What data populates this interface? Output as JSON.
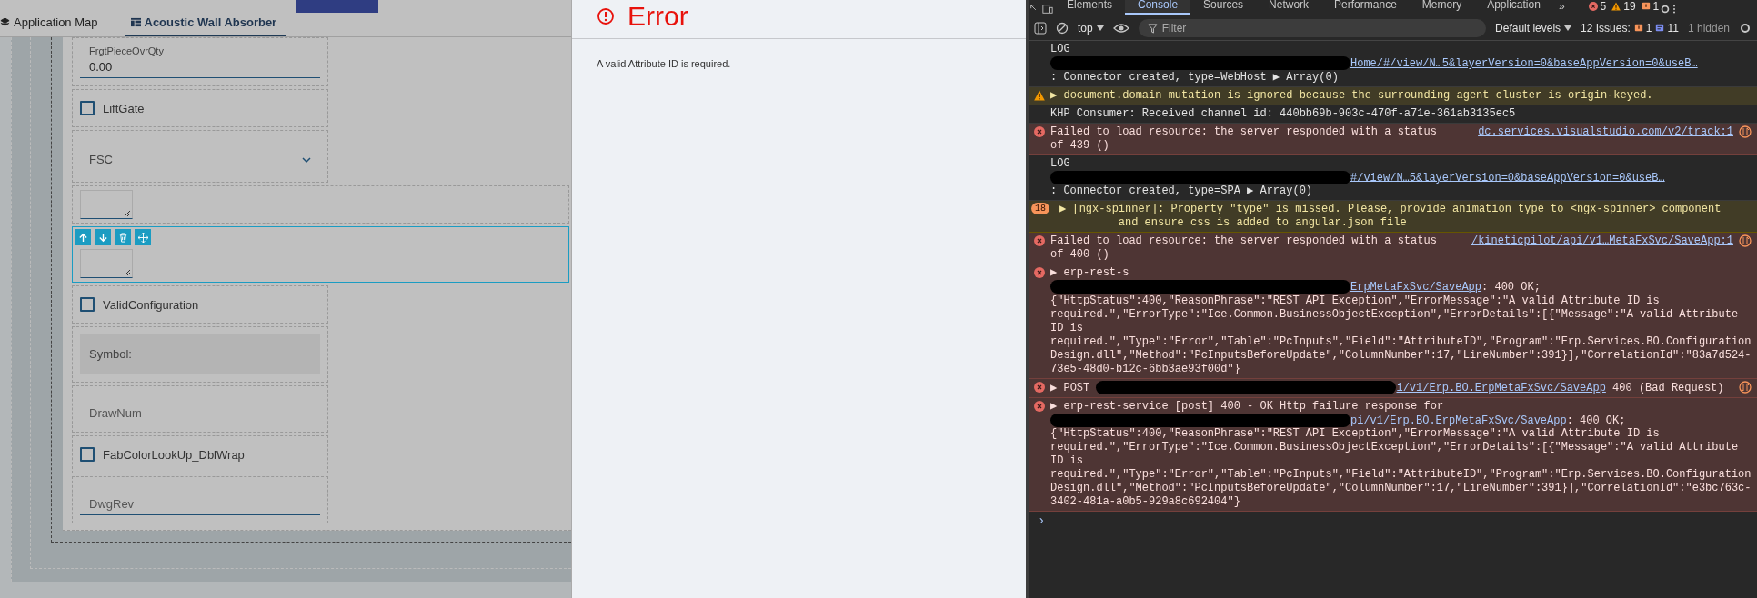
{
  "app": {
    "tabs": [
      {
        "label": "Application Map",
        "selected": false
      },
      {
        "label": "Acoustic Wall Absorber",
        "selected": true
      }
    ],
    "fields": [
      {
        "kind": "number",
        "label": "FrgtPieceOvrQty",
        "value": "0.00",
        "selected": false
      },
      {
        "kind": "checkbox",
        "label": "LiftGate",
        "checked": false,
        "selected": false
      },
      {
        "kind": "dropdown",
        "placeholder": "FSC",
        "selected": false
      },
      {
        "kind": "textarea",
        "selected": false
      },
      {
        "kind": "textarea",
        "selected": true
      },
      {
        "kind": "checkbox",
        "label": "ValidConfiguration",
        "checked": false,
        "selected": false
      },
      {
        "kind": "readonly",
        "placeholder": "Symbol:",
        "selected": false
      },
      {
        "kind": "text",
        "placeholder": "DrawNum",
        "selected": false
      },
      {
        "kind": "checkbox",
        "label": "FabColorLookUp_DblWrap",
        "checked": false,
        "selected": false
      },
      {
        "kind": "text",
        "placeholder": "DwgRev",
        "selected": false
      }
    ]
  },
  "error_dialog": {
    "title": "Error",
    "message": "A valid Attribute ID is required."
  },
  "devtools": {
    "tabs": [
      {
        "label": "Elements",
        "selected": false
      },
      {
        "label": "Console",
        "selected": true
      },
      {
        "label": "Sources",
        "selected": false
      },
      {
        "label": "Network",
        "selected": false
      },
      {
        "label": "Performance",
        "selected": false
      },
      {
        "label": "Memory",
        "selected": false
      },
      {
        "label": "Application",
        "selected": false
      }
    ],
    "more": "»",
    "error_count": "5",
    "warning_count": "19",
    "issue_count": "1",
    "toolbar": {
      "context": "top",
      "filter_placeholder": "Filter",
      "levels": "Default levels",
      "issues_label": "12 Issues:",
      "issues_errors": "1",
      "issues_info": "11",
      "hidden": "1 hidden"
    },
    "messages": [
      {
        "kind": "log",
        "segments": [
          {
            "kind": "text",
            "text": "LOG\n"
          },
          {
            "kind": "redaction"
          },
          {
            "kind": "link",
            "text": "Home/#/view/N…5&layerVersion=0&baseAppVersion=0&useB…"
          },
          {
            "kind": "text",
            "text": "\n: Connector created, type=WebHost ▶ Array(0)"
          }
        ]
      },
      {
        "kind": "warning",
        "segments": [
          {
            "kind": "text",
            "text": "▶ document.domain mutation is ignored because the surrounding agent cluster is origin-keyed."
          }
        ]
      },
      {
        "kind": "log",
        "segments": [
          {
            "kind": "text",
            "text": "KHP Consumer: Received channel id: 440bb69b-903c-470f-a71e-361ab3135ec5"
          }
        ]
      },
      {
        "kind": "error",
        "network_icon": true,
        "source": "dc.services.visualstudio.com/v2/track:1",
        "segments": [
          {
            "kind": "text",
            "text": "Failed to load resource: the server responded with a status of 439 ()"
          }
        ]
      },
      {
        "kind": "log",
        "segments": [
          {
            "kind": "text",
            "text": "LOG\n"
          },
          {
            "kind": "redaction"
          },
          {
            "kind": "link",
            "text": "#/view/N…5&layerVersion=0&baseAppVersion=0&useB…"
          },
          {
            "kind": "text",
            "text": "\n: Connector created, type=SPA ▶ Array(0)"
          }
        ]
      },
      {
        "kind": "warning",
        "count": "18",
        "segments": [
          {
            "kind": "text",
            "text": "▶ [ngx-spinner]: Property \"type\" is missed. Please, provide animation type to <ngx-spinner> component\n         and ensure css is added to angular.json file"
          }
        ]
      },
      {
        "kind": "error",
        "network_icon": true,
        "source": "/kineticpilot/api/v1…MetaFxSvc/SaveApp:1",
        "segments": [
          {
            "kind": "text",
            "text": "Failed to load resource: the server responded with a status of 400 ()"
          }
        ]
      },
      {
        "kind": "error",
        "network_icon": false,
        "segments": [
          {
            "kind": "text",
            "text": "▶ erp-rest-s\n"
          },
          {
            "kind": "redaction"
          },
          {
            "kind": "link",
            "text": "ErpMetaFxSvc/SaveApp"
          },
          {
            "kind": "text",
            "text": ": 400 OK;\n{\"HttpStatus\":400,\"ReasonPhrase\":\"REST API Exception\",\"ErrorMessage\":\"A valid Attribute ID is required.\",\"ErrorType\":\"Ice.Common.BusinessObjectException\",\"ErrorDetails\":[{\"Message\":\"A valid Attribute ID is required.\",\"Type\":\"Error\",\"Table\":\"PcInputs\",\"Field\":\"AttributeID\",\"Program\":\"Erp.Services.BO.ConfigurationDesign.dll\",\"Method\":\"PcInputsBeforeUpdate\",\"ColumnNumber\":17,\"LineNumber\":391}],\"CorrelationId\":\"83a7d524-73e5-48d0-b12c-6bb3ae93f00d\"}"
          }
        ]
      },
      {
        "kind": "error",
        "network_icon": true,
        "segments": [
          {
            "kind": "text",
            "text": "▶ POST "
          },
          {
            "kind": "redaction"
          },
          {
            "kind": "link",
            "text": "i/v1/Erp.BO.ErpMetaFxSvc/SaveApp"
          },
          {
            "kind": "text",
            "text": " 400 (Bad Request)"
          }
        ]
      },
      {
        "kind": "error",
        "network_icon": false,
        "segments": [
          {
            "kind": "text",
            "text": "▶ erp-rest-service [post] 400 - OK Http failure response for\n"
          },
          {
            "kind": "redaction"
          },
          {
            "kind": "link",
            "text": "pi/v1/Erp.BO.ErpMetaFxSvc/SaveApp"
          },
          {
            "kind": "text",
            "text": ": 400 OK;\n{\"HttpStatus\":400,\"ReasonPhrase\":\"REST API Exception\",\"ErrorMessage\":\"A valid Attribute ID is required.\",\"ErrorType\":\"Ice.Common.BusinessObjectException\",\"ErrorDetails\":[{\"Message\":\"A valid Attribute ID is required.\",\"Type\":\"Error\",\"Table\":\"PcInputs\",\"Field\":\"AttributeID\",\"Program\":\"Erp.Services.BO.ConfigurationDesign.dll\",\"Method\":\"PcInputsBeforeUpdate\",\"ColumnNumber\":17,\"LineNumber\":391}],\"CorrelationId\":\"e3bc763c-3402-481a-a0b5-929a8c692404\"}"
          }
        ]
      }
    ],
    "prompt": "›"
  }
}
